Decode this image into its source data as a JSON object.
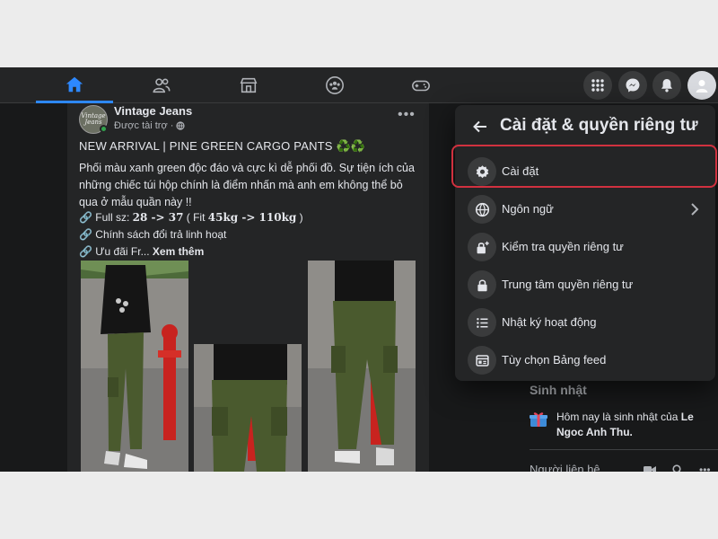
{
  "nav": {
    "tabs": [
      {
        "icon": "home-icon",
        "active": true
      },
      {
        "icon": "friends-icon",
        "active": false
      },
      {
        "icon": "marketplace-icon",
        "active": false
      },
      {
        "icon": "groups-icon",
        "active": false
      },
      {
        "icon": "gaming-icon",
        "active": false
      }
    ],
    "right_buttons": [
      "menu-grid-icon",
      "messenger-icon",
      "notifications-bell-icon",
      "account-avatar"
    ],
    "accent_color": "#2d88ff"
  },
  "post": {
    "page_name": "Vintage Jeans",
    "avatar_text": "Vintage Jeans",
    "sponsored": "Được tài trợ ·",
    "title": "NEW ARRIVAL | PINE GREEN CARGO PANTS ♻️♻️",
    "body": "Phối màu xanh green độc đáo và cực kì dễ phối đồ. Sự tiện ích của những chiếc túi hộp chính là điểm nhấn mà anh em không thể bỏ qua ở mẫu quần này !!",
    "line1_prefix": "Full sz: ",
    "line1_size": "28 -> 37",
    "line1_mid": " ( Fit ",
    "line1_weight": "45kg -> 110kg",
    "line1_end": " )",
    "line2": "Chính sách đổi trả linh hoạt",
    "line3": "Ưu đãi Fr...",
    "see_more": "Xem thêm",
    "photos_count": 3
  },
  "sidebar": {
    "birthday_title": "Sinh nhật",
    "birthday_text": "Hôm nay là sinh nhật của",
    "birthday_name": "Le Ngoc Anh Thu.",
    "contacts_title": "Người liên hệ"
  },
  "panel": {
    "title": "Cài đặt & quyền riêng tư",
    "items": [
      {
        "label": "Cài đặt",
        "icon": "gear-icon",
        "highlighted": true
      },
      {
        "label": "Ngôn ngữ",
        "icon": "globe-icon",
        "has_arrow": true
      },
      {
        "label": "Kiểm tra quyền riêng tư",
        "icon": "lock-plus-icon"
      },
      {
        "label": "Trung tâm quyền riêng tư",
        "icon": "lock-icon"
      },
      {
        "label": "Nhật ký hoạt động",
        "icon": "activity-list-icon"
      },
      {
        "label": "Tùy chọn Bảng feed",
        "icon": "feed-preferences-icon"
      }
    ],
    "highlight_color": "#d1313f"
  }
}
